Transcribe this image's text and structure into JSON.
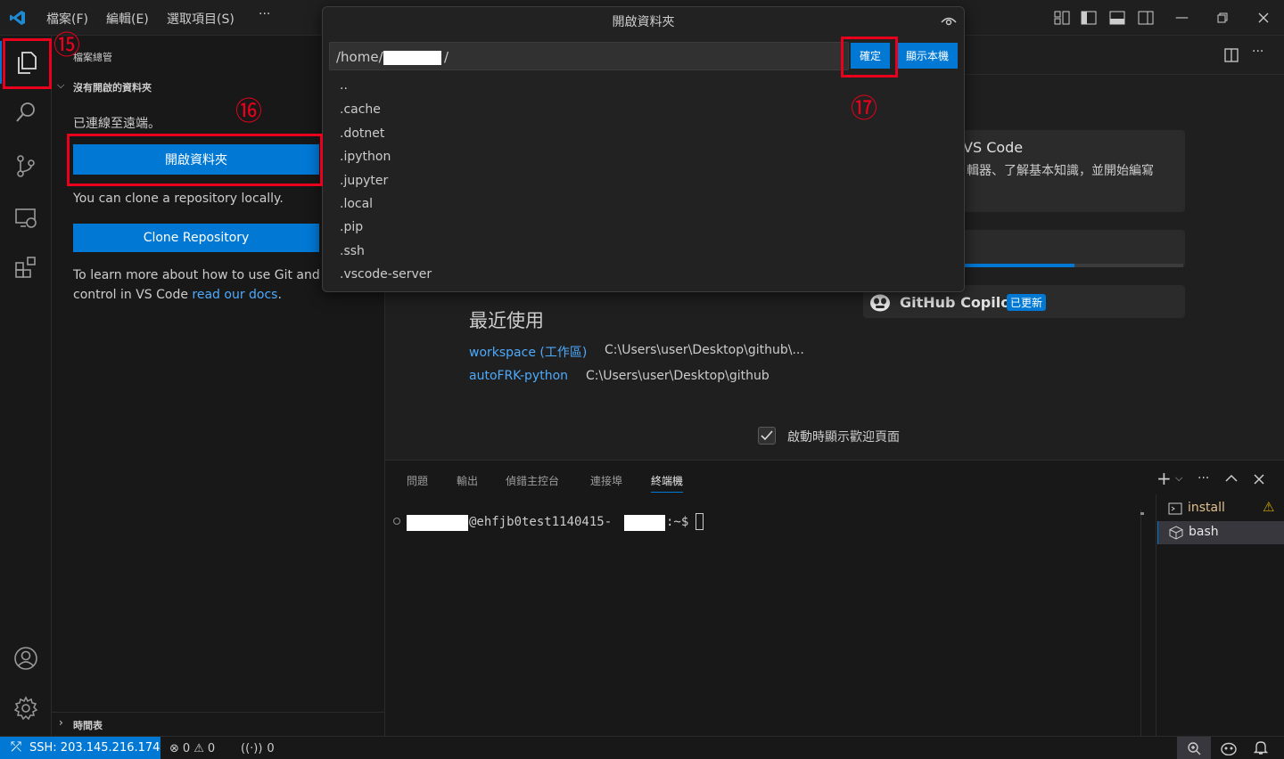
{
  "titlebar": {
    "menus": [
      "檔案(F)",
      "編輯(E)",
      "選取項目(S)",
      "···"
    ]
  },
  "sidebar": {
    "title": "檔案總管",
    "section_header": "沒有開啟的資料夾",
    "connected_text": "已連線至遠端。",
    "open_folder_label": "開啟資料夾",
    "clone_text": "You can clone a repository locally.",
    "clone_button_label": "Clone Repository",
    "learn_text_1": "To learn more about how to use Git and",
    "learn_text_2": "control in VS Code ",
    "learn_link": "read our docs",
    "learn_end": ".",
    "timeline_label": "時間表"
  },
  "quickpick": {
    "title": "開啟資料夾",
    "input_prefix": "/home/",
    "input_suffix": "/",
    "ok_label": "確定",
    "show_local_label": "顯示本機",
    "items": [
      "..",
      ".cache",
      ".dotnet",
      ".ipython",
      ".jupyter",
      ".local",
      ".pip",
      ".ssh",
      ".vscode-server"
    ]
  },
  "welcome": {
    "card1_title": "VS Code",
    "card1_desc": "輯器、了解基本知識，並開始編寫",
    "progress": 0.5,
    "copilot_label": "GitHub Copilot",
    "copilot_badge": "已更新",
    "recent_title": "最近使用",
    "recent": [
      {
        "name": "workspace (工作區)",
        "path": "C:\\Users\\user\\Desktop\\github\\..."
      },
      {
        "name": "autoFRK-python",
        "path": "C:\\Users\\user\\Desktop\\github"
      }
    ],
    "show_on_startup": "啟動時顯示歡迎頁面"
  },
  "panel": {
    "tabs": [
      "問題",
      "輸出",
      "偵錯主控台",
      "連接埠",
      "終端機"
    ],
    "active_tab": "終端機",
    "terminal_host": "@ehfjb0test1140415-",
    "terminal_prompt": ":~$",
    "terminals": [
      "install",
      "bash"
    ]
  },
  "statusbar": {
    "remote": "SSH: 203.145.216.174",
    "errors": "0",
    "warnings": "0",
    "ports": "0"
  },
  "annotations": {
    "n15": "⑮",
    "n16": "⑯",
    "n17": "⑰"
  },
  "colors": {
    "accent": "#0078d4",
    "highlight": "#e8001c",
    "link": "#4daafc"
  }
}
